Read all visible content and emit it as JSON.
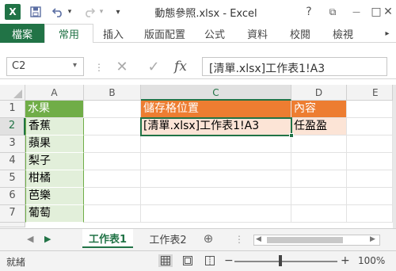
{
  "app": {
    "window_title": "動態參照.xlsx - Excel"
  },
  "titlebar": {
    "excel_logo": "X",
    "help": "?",
    "restore": "⧉",
    "minimize": "—",
    "maximize": "□",
    "close": "✕"
  },
  "ribbon": {
    "tabs": [
      "檔案",
      "常用",
      "插入",
      "版面配置",
      "公式",
      "資料",
      "校閱",
      "檢視"
    ],
    "active_tab": "常用"
  },
  "formula_bar": {
    "name_box": "C2",
    "cancel_symbol": "✕",
    "enter_symbol": "✓",
    "fx_label": "fx",
    "formula": "[清單.xlsx]工作表1!A3"
  },
  "grid": {
    "columns": [
      "A",
      "B",
      "C",
      "D",
      "E"
    ],
    "rows": [
      "1",
      "2",
      "3",
      "4",
      "5",
      "6",
      "7"
    ],
    "colA": [
      "水果",
      "香蕉",
      "蘋果",
      "梨子",
      "柑橘",
      "芭樂",
      "葡萄"
    ],
    "c1": "儲存格位置",
    "d1": "內容",
    "c2": "[清單.xlsx]工作表1!A3",
    "d2": "任盈盈"
  },
  "sheets": {
    "tabs": [
      "工作表1",
      "工作表2"
    ],
    "active": "工作表1",
    "add": "⊕"
  },
  "statusbar": {
    "status": "就緒",
    "zoom_minus": "−",
    "zoom_plus": "+",
    "zoom": "100%"
  },
  "colors": {
    "accent": "#217346",
    "green_header": "#70ad47",
    "green_fill": "#e2efda",
    "orange_header": "#ed7d31",
    "orange_fill": "#fce4d6"
  }
}
